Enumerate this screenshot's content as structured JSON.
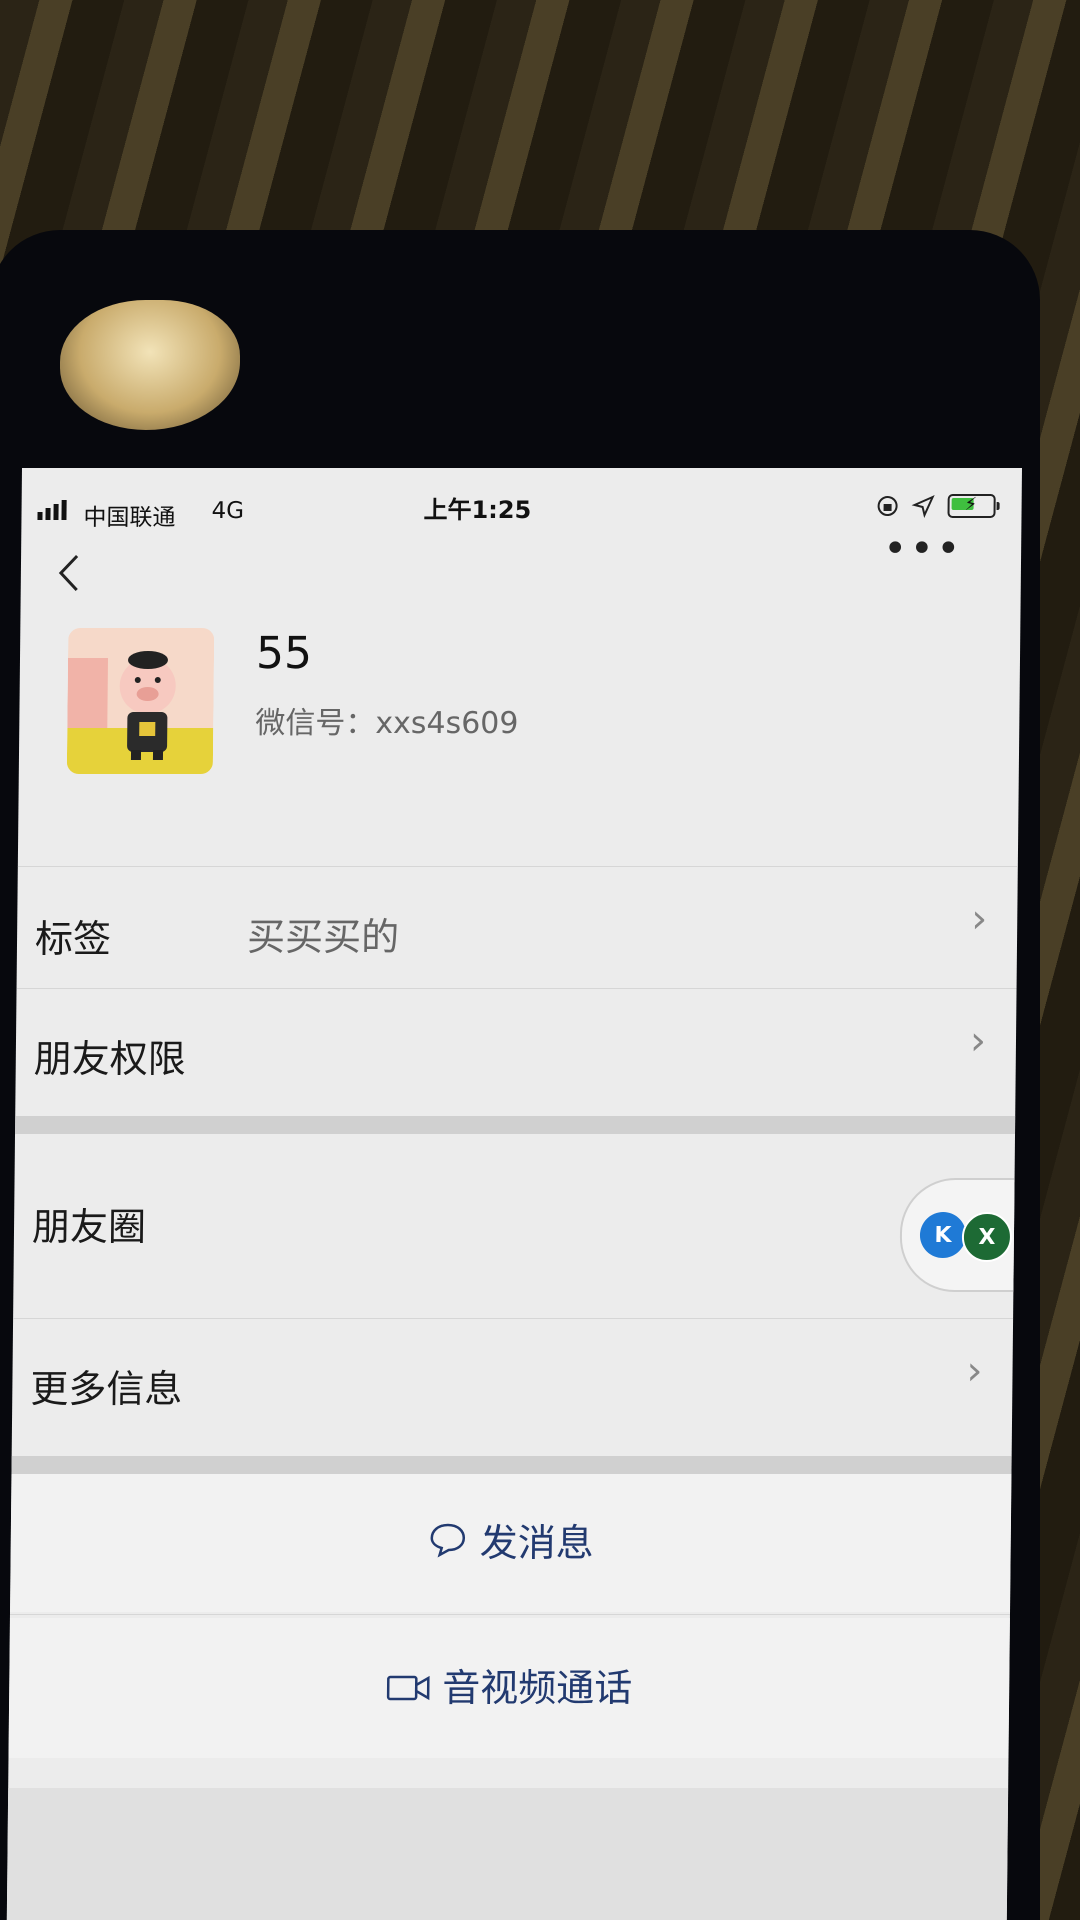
{
  "status_bar": {
    "carrier": "中国联通",
    "network": "4G",
    "time": "上午1:25"
  },
  "nav": {
    "back_icon": "chevron-left-icon",
    "more_icon": "more-dots-icon",
    "more_label": "•••"
  },
  "profile": {
    "name": "55",
    "wechat_id": "微信号：xxs4s609",
    "avatar_icon": "pig-cartoon-avatar"
  },
  "rows": [
    {
      "label": "标签",
      "value": "买买买的"
    },
    {
      "label": "朋友权限",
      "value": ""
    },
    {
      "label": "朋友圈",
      "value": ""
    },
    {
      "label": "更多信息",
      "value": ""
    }
  ],
  "moments_bubble": {
    "letter_a": "K",
    "letter_b": "X"
  },
  "actions": {
    "send_message": "发消息",
    "video_call": "音视频通话"
  },
  "chevron": "›",
  "colors": {
    "screen_bg": "#ececec",
    "action_text": "#223a70",
    "battery_green": "#3fbf3f"
  }
}
